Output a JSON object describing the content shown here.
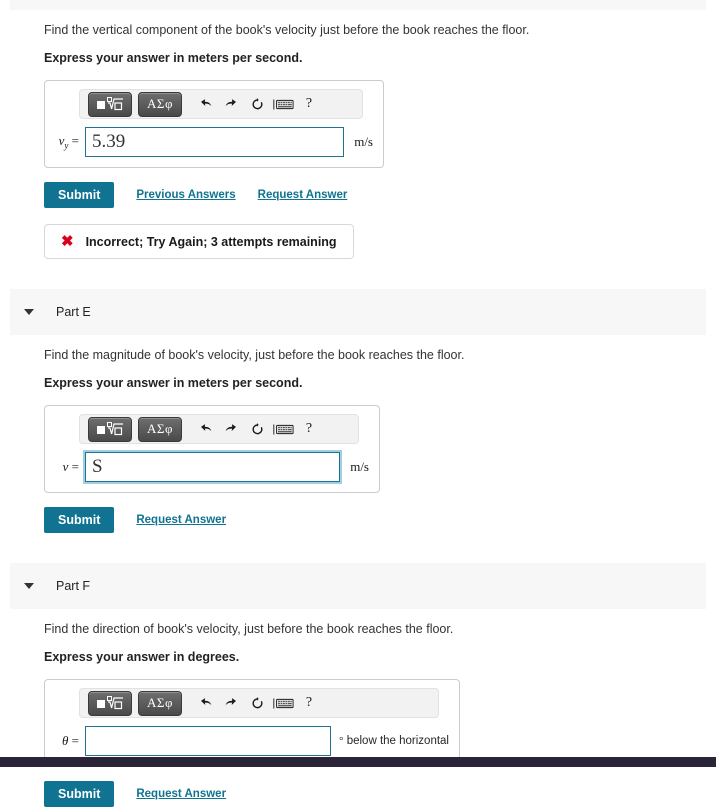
{
  "parts": [
    {
      "id": "part-d",
      "header_label": null,
      "question": "Find the vertical component of the book's velocity just before the book reaches the floor.",
      "instruction": "Express your answer in meters per second.",
      "toolbar": {
        "template_button": "template-matrix-radical",
        "symbol_button": "ΑΣφ",
        "undo_icon": "↰",
        "redo_icon": "↱",
        "reset_icon": "↻",
        "keyboard_icon": "keyboard",
        "help_icon": "?"
      },
      "variable": "v",
      "subscript": "y",
      "equals": "=",
      "value": "5.39",
      "placeholder": "",
      "unit": "m/s",
      "focused": false,
      "submit_label": "Submit",
      "links": [
        "Previous Answers",
        "Request Answer"
      ],
      "feedback": {
        "icon": "✖",
        "text": "Incorrect; Try Again; 3 attempts remaining",
        "color": "#d9001b"
      }
    },
    {
      "id": "part-e",
      "header_label": "Part E",
      "question": "Find the magnitude of book's velocity, just before the book reaches the floor.",
      "instruction": "Express your answer in meters per second.",
      "toolbar": {
        "template_button": "template-matrix-radical",
        "symbol_button": "ΑΣφ",
        "undo_icon": "↰",
        "redo_icon": "↱",
        "reset_icon": "↻",
        "keyboard_icon": "keyboard",
        "help_icon": "?"
      },
      "variable": "v",
      "subscript": "",
      "equals": "=",
      "value": "S",
      "placeholder": "",
      "unit": "m/s",
      "focused": true,
      "submit_label": "Submit",
      "links": [
        "Request Answer"
      ],
      "feedback": null
    },
    {
      "id": "part-f",
      "header_label": "Part F",
      "question": "Find the direction of book's velocity, just before the book reaches the floor.",
      "instruction": "Express your answer in degrees.",
      "toolbar": {
        "template_button": "template-matrix-radical",
        "symbol_button": "ΑΣφ",
        "undo_icon": "↰",
        "redo_icon": "↱",
        "reset_icon": "↻",
        "keyboard_icon": "keyboard",
        "help_icon": "?"
      },
      "variable": "θ",
      "subscript": "",
      "equals": "=",
      "value": "",
      "placeholder": "",
      "unit_degree_symbol": "°",
      "unit": "below the horizontal",
      "focused": false,
      "submit_label": "Submit",
      "links": [
        "Request Answer"
      ],
      "feedback": null
    }
  ],
  "colors": {
    "accent": "#0f7391",
    "error": "#d9001b",
    "input_border": "#1f7391",
    "header_band": "#f7f7f7",
    "bottom_bar": "#2b2438"
  }
}
